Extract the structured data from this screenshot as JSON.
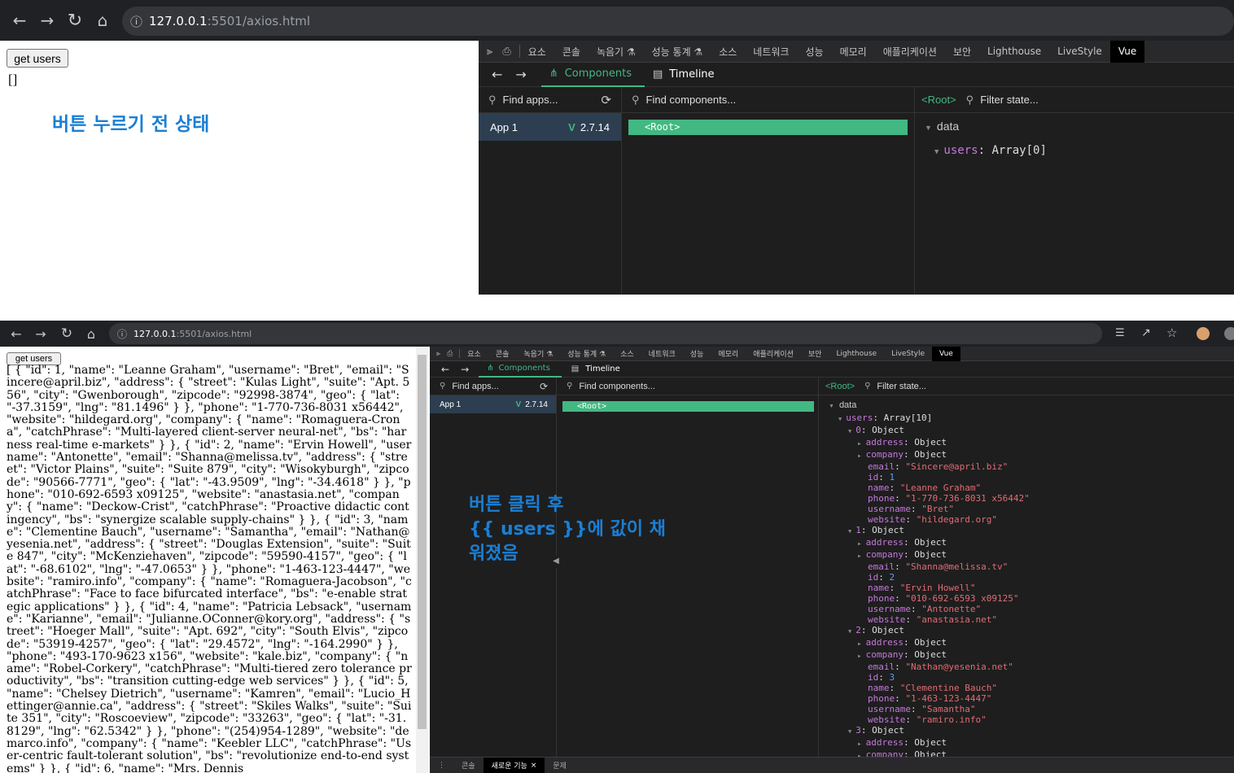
{
  "browser": {
    "url_host": "127.0.0.1",
    "url_path": ":5501/axios.html"
  },
  "page": {
    "button_label": "get users",
    "empty_output": "[]",
    "annotation_before": "버튼 누르기 전 상태",
    "annotation_after_lines": [
      "버튼 클릭 후",
      "{{ users }}에 값이 채",
      "워졌음"
    ],
    "json_output": "[ { \"id\": 1, \"name\": \"Leanne Graham\", \"username\": \"Bret\", \"email\": \"Sincere@april.biz\", \"address\": { \"street\": \"Kulas Light\", \"suite\": \"Apt. 556\", \"city\": \"Gwenborough\", \"zipcode\": \"92998-3874\", \"geo\": { \"lat\": \"-37.3159\", \"lng\": \"81.1496\" } }, \"phone\": \"1-770-736-8031 x56442\", \"website\": \"hildegard.org\", \"company\": { \"name\": \"Romaguera-Crona\", \"catchPhrase\": \"Multi-layered client-server neural-net\", \"bs\": \"harness real-time e-markets\" } }, { \"id\": 2, \"name\": \"Ervin Howell\", \"username\": \"Antonette\", \"email\": \"Shanna@melissa.tv\", \"address\": { \"street\": \"Victor Plains\", \"suite\": \"Suite 879\", \"city\": \"Wisokyburgh\", \"zipcode\": \"90566-7771\", \"geo\": { \"lat\": \"-43.9509\", \"lng\": \"-34.4618\" } }, \"phone\": \"010-692-6593 x09125\", \"website\": \"anastasia.net\", \"company\": { \"name\": \"Deckow-Crist\", \"catchPhrase\": \"Proactive didactic contingency\", \"bs\": \"synergize scalable supply-chains\" } }, { \"id\": 3, \"name\": \"Clementine Bauch\", \"username\": \"Samantha\", \"email\": \"Nathan@yesenia.net\", \"address\": { \"street\": \"Douglas Extension\", \"suite\": \"Suite 847\", \"city\": \"McKenziehaven\", \"zipcode\": \"59590-4157\", \"geo\": { \"lat\": \"-68.6102\", \"lng\": \"-47.0653\" } }, \"phone\": \"1-463-123-4447\", \"website\": \"ramiro.info\", \"company\": { \"name\": \"Romaguera-Jacobson\", \"catchPhrase\": \"Face to face bifurcated interface\", \"bs\": \"e-enable strategic applications\" } }, { \"id\": 4, \"name\": \"Patricia Lebsack\", \"username\": \"Karianne\", \"email\": \"Julianne.OConner@kory.org\", \"address\": { \"street\": \"Hoeger Mall\", \"suite\": \"Apt. 692\", \"city\": \"South Elvis\", \"zipcode\": \"53919-4257\", \"geo\": { \"lat\": \"29.4572\", \"lng\": \"-164.2990\" } }, \"phone\": \"493-170-9623 x156\", \"website\": \"kale.biz\", \"company\": { \"name\": \"Robel-Corkery\", \"catchPhrase\": \"Multi-tiered zero tolerance productivity\", \"bs\": \"transition cutting-edge web services\" } }, { \"id\": 5, \"name\": \"Chelsey Dietrich\", \"username\": \"Kamren\", \"email\": \"Lucio_Hettinger@annie.ca\", \"address\": { \"street\": \"Skiles Walks\", \"suite\": \"Suite 351\", \"city\": \"Roscoeview\", \"zipcode\": \"33263\", \"geo\": { \"lat\": \"-31.8129\", \"lng\": \"62.5342\" } }, \"phone\": \"(254)954-1289\", \"website\": \"demarco.info\", \"company\": { \"name\": \"Keebler LLC\", \"catchPhrase\": \"User-centric fault-tolerant solution\", \"bs\": \"revolutionize end-to-end systems\" } }, { \"id\": 6, \"name\": \"Mrs. Dennis"
  },
  "devtools": {
    "tabs": [
      "요소",
      "콘솔",
      "녹음기 ⚗",
      "성능 통계 ⚗",
      "소스",
      "네트워크",
      "성능",
      "메모리",
      "애플리케이션",
      "보안",
      "Lighthouse",
      "LiveStyle",
      "Vue"
    ],
    "vue_tabs": [
      "Components",
      "Timeline"
    ],
    "find_apps_placeholder": "Find apps...",
    "find_components_placeholder": "Find components...",
    "filter_state_placeholder": "Filter state...",
    "root_tag": "<Root>",
    "app_name": "App 1",
    "vue_version": "2.7.14",
    "section_data": "data",
    "users_key": "users",
    "users_before": "Array[0]",
    "users_after": "Array[10]",
    "drawer_tabs": [
      "콘솔",
      "새로운 기능",
      "문제"
    ],
    "objects": [
      {
        "index": "0",
        "type": "Object",
        "email": "\"Sincere@april.biz\"",
        "id": "1",
        "name": "\"Leanne Graham\"",
        "phone": "\"1-770-736-8031 x56442\"",
        "username": "\"Bret\"",
        "website": "\"hildegard.org\""
      },
      {
        "index": "1",
        "type": "Object",
        "email": "\"Shanna@melissa.tv\"",
        "id": "2",
        "name": "\"Ervin Howell\"",
        "phone": "\"010-692-6593 x09125\"",
        "username": "\"Antonette\"",
        "website": "\"anastasia.net\""
      },
      {
        "index": "2",
        "type": "Object",
        "email": "\"Nathan@yesenia.net\"",
        "id": "3",
        "name": "\"Clementine Bauch\"",
        "phone": "\"1-463-123-4447\"",
        "username": "\"Samantha\"",
        "website": "\"ramiro.info\""
      },
      {
        "index": "3",
        "type": "Object",
        "email": "\"Julianne.OConner@kory.org\""
      }
    ]
  }
}
